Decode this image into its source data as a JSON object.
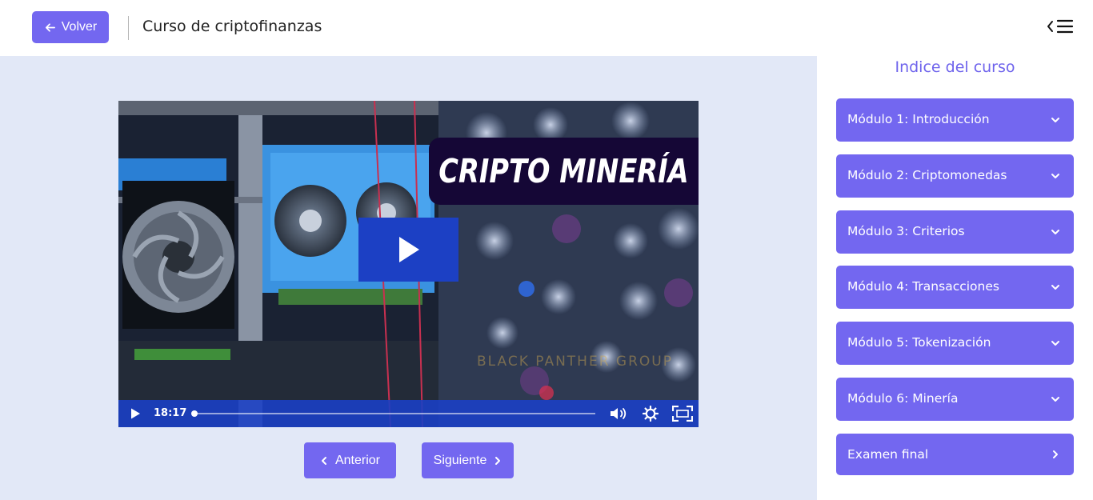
{
  "header": {
    "back_label": "Volver",
    "course_title": "Curso de criptofinanzas"
  },
  "video": {
    "title_overlay": "CRIPTO MINERÍA",
    "watermark": "BLACK PANTHER GROUP",
    "time": "18:17",
    "progress": 0.005
  },
  "navigation": {
    "prev_label": "Anterior",
    "next_label": "Siguiente"
  },
  "sidebar": {
    "title": "Indice del curso",
    "modules": [
      {
        "label": "Módulo 1: Introducción"
      },
      {
        "label": "Módulo 2: Criptomonedas"
      },
      {
        "label": "Módulo 3: Criterios"
      },
      {
        "label": "Módulo 4: Transacciones"
      },
      {
        "label": "Módulo 5: Tokenización"
      },
      {
        "label": "Módulo 6: Minería"
      },
      {
        "label": "Examen final"
      }
    ]
  },
  "colors": {
    "accent": "#7367f0",
    "player_blue": "#1c40c4",
    "content_bg": "#e2e8f7",
    "title_box": "#150736"
  },
  "icons": [
    "arrow-left-icon",
    "sidebar-toggle-icon",
    "play-icon",
    "volume-icon",
    "settings-icon",
    "fullscreen-icon",
    "chevron-left-icon",
    "chevron-right-icon",
    "chevron-down-icon"
  ]
}
